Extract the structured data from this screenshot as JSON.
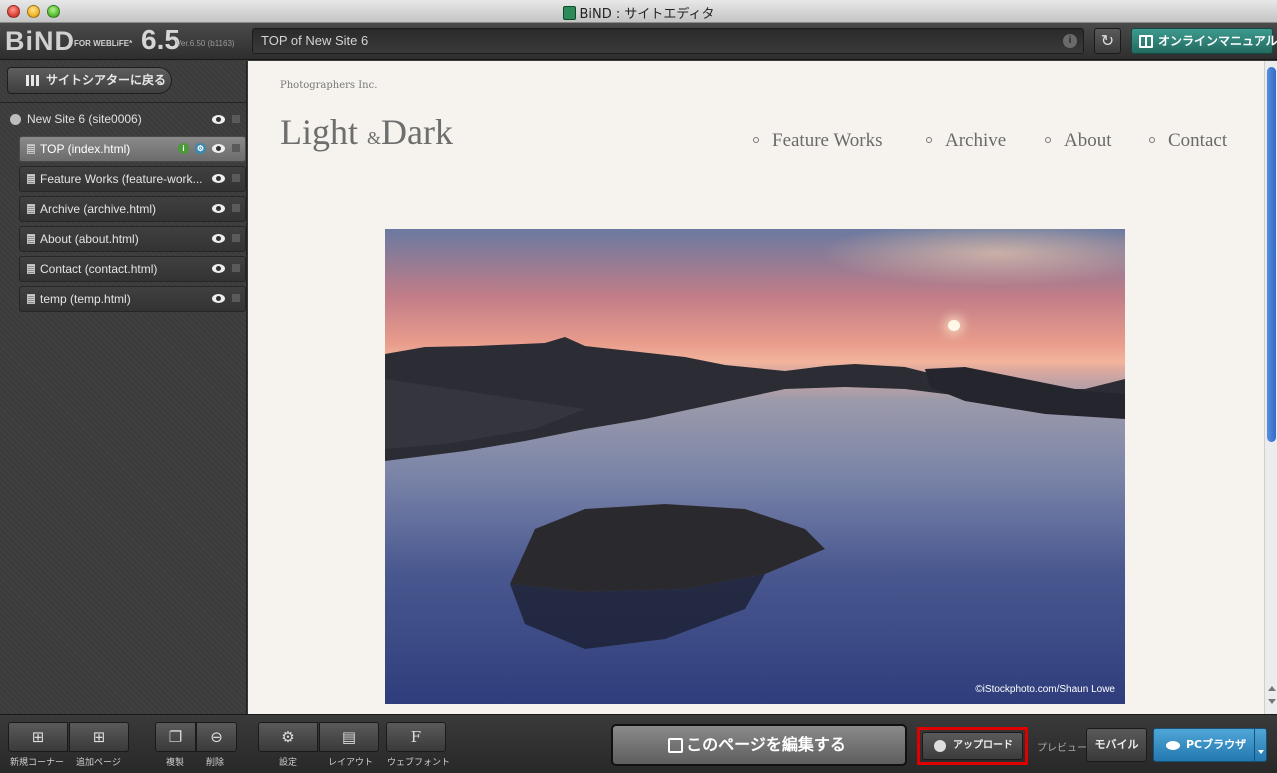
{
  "window": {
    "title": "BiND : サイトエディタ"
  },
  "app": {
    "logo": "BiND",
    "for_weblife": "FOR WEBLiFE*",
    "version": "6.5",
    "build": "Ver.6.50 (b1163)"
  },
  "toolbar": {
    "url": "TOP of New Site 6",
    "manual_label": "オンラインマニュアル"
  },
  "sidebar": {
    "back_label": "サイトシアターに戻る",
    "site": "New Site 6 (site0006)",
    "pages": [
      {
        "label": "TOP (index.html)"
      },
      {
        "label": "Feature Works (feature-work..."
      },
      {
        "label": "Archive (archive.html)"
      },
      {
        "label": "About (about.html)"
      },
      {
        "label": "Contact (contact.html)"
      },
      {
        "label": "temp (temp.html)"
      }
    ]
  },
  "site_preview": {
    "company": "Photographers Inc.",
    "brand_left": "Light",
    "brand_amp": "&",
    "brand_right": "Dark",
    "nav": [
      "Feature Works",
      "Archive",
      "About",
      "Contact"
    ],
    "photo_credit": "©iStockphoto.com/Shaun Lowe"
  },
  "bottom": {
    "new_corner": "新規コーナー",
    "add_page": "追加ページ",
    "duplicate": "複製",
    "delete": "削除",
    "settings": "設定",
    "layout": "レイアウト",
    "webfont": "ウェブフォント",
    "webfont_glyph": "F",
    "edit_page": "このページを編集する",
    "upload": "アップロード",
    "preview_label": "プレビュー",
    "mobile": "モバイル",
    "pc_browser": "PCブラウザ"
  },
  "colors": {
    "accent_teal": "#2f8a7e",
    "accent_blue": "#2f86c4",
    "highlight_red": "#e00000"
  }
}
